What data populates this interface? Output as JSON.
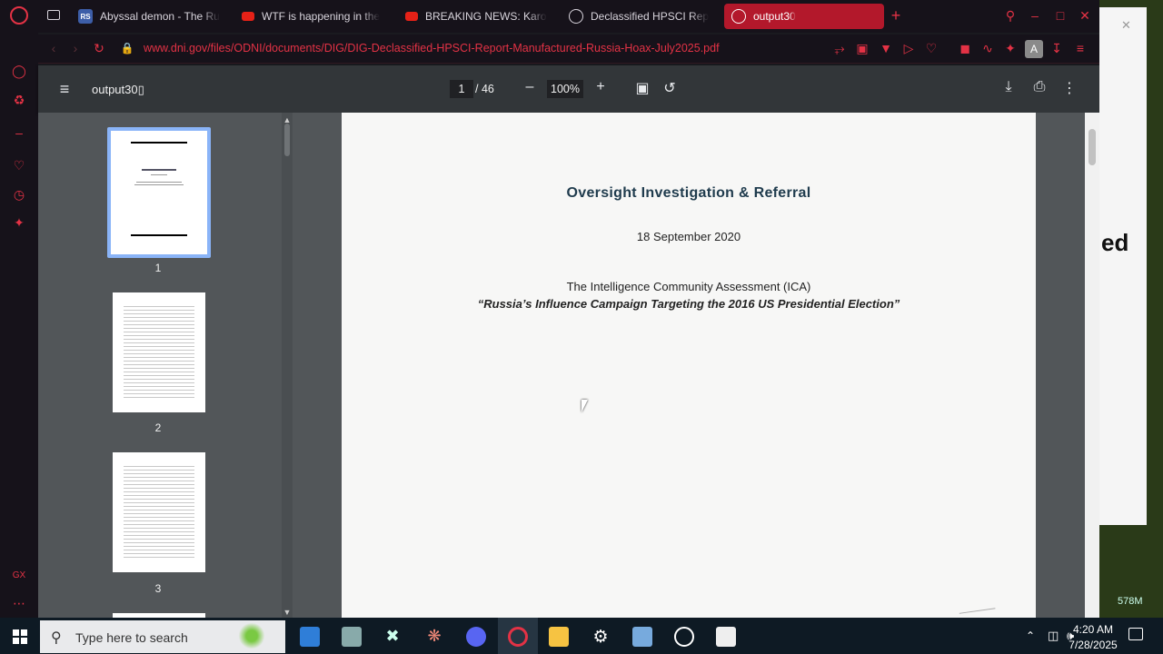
{
  "tabs": [
    {
      "label": "Abyssal demon - The Run",
      "favicon": "runescape-wiki-icon"
    },
    {
      "label": "WTF is happening in the",
      "favicon": "youtube-icon"
    },
    {
      "label": "BREAKING NEWS: Karolin",
      "favicon": "youtube-icon"
    },
    {
      "label": "Declassified HPSCI Repo",
      "favicon": "globe-icon"
    },
    {
      "label": "output30",
      "favicon": "globe-icon",
      "active": true
    }
  ],
  "address": {
    "url": "www.dni.gov/files/ODNI/documents/DIG/DIG-Declassified-HPSCI-Report-Manufactured-Russia-Hoax-July2025.pdf"
  },
  "pdf": {
    "title": "output30\u0000",
    "title_display": "output30▯",
    "current_page": "1",
    "total_pages": "/ 46",
    "zoom": "100%",
    "thumbnails": [
      "1",
      "2",
      "3"
    ]
  },
  "document": {
    "heading": "Oversight Investigation & Referral",
    "date": "18 September 2020",
    "subject": "The Intelligence Community Assessment (ICA)",
    "subtitle": "“Russia’s Influence Campaign Targeting the 2016 US Presidential Election”"
  },
  "right_app": {
    "partial_text": "ed",
    "stat": "578M"
  },
  "taskbar": {
    "search_placeholder": "Type here to search",
    "time": "4:20 AM",
    "date": "7/28/2025"
  },
  "colors": {
    "accent": "#e33245",
    "active_tab": "#b3182b",
    "pdf_toolbar": "#323639",
    "viewer_bg": "#525659"
  }
}
